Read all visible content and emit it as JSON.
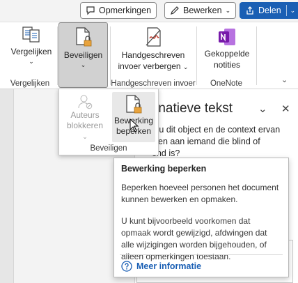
{
  "header": {
    "comments_label": "Opmerkingen",
    "editing_label": "Bewerken",
    "share_label": "Delen"
  },
  "ribbon": {
    "groups": {
      "compare": {
        "button_label": "Vergelijken",
        "group_label": "Vergelijken"
      },
      "protect": {
        "button_label": "Beveiligen"
      },
      "ink": {
        "button_line1": "Handgeschreven",
        "button_line2": "invoer verbergen",
        "group_label": "Handgeschreven invoer"
      },
      "onenote": {
        "button_line1": "Gekoppelde",
        "button_line2": "notities",
        "group_label": "OneNote"
      }
    },
    "collapse_icon": "chevron-down-icon"
  },
  "dropdown": {
    "items": [
      {
        "line1": "Auteurs",
        "line2": "blokkeren",
        "enabled": false
      },
      {
        "line1": "Bewerking",
        "line2": "beperken",
        "enabled": true
      }
    ],
    "group_label": "Beveiligen"
  },
  "pane": {
    "title": "rnatieve tekst",
    "text_line1": "u u dit object en de context ervan",
    "text_line2": "jven aan iemand die blind of",
    "text_line3": "end is?"
  },
  "tooltip": {
    "title": "Bewerking beperken",
    "paragraph1": "Beperken hoeveel personen het document kunnen bewerken en opmaken.",
    "paragraph2": "U kunt bijvoorbeeld voorkomen dat opmaak wordt gewijzigd, afdwingen dat alle wijzigingen worden bijgehouden, of alleen opmerkingen toestaan.",
    "link_label": "Meer informatie"
  },
  "colors": {
    "accent": "#1a5fb4",
    "onenote": "#7719aa",
    "lock": "#e8a33d"
  }
}
